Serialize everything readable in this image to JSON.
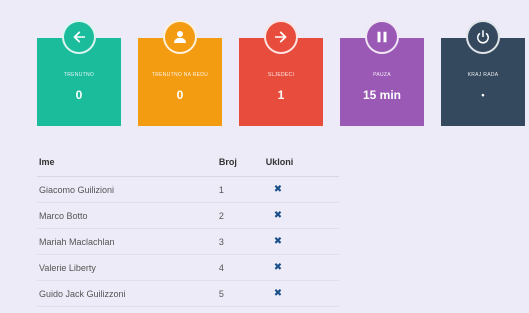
{
  "tiles": [
    {
      "label": "Trenutno",
      "value": "0",
      "icon": "arrow-left-icon",
      "color": "#1abc9c"
    },
    {
      "label": "Trenutno na redu",
      "value": "0",
      "icon": "user-icon",
      "color": "#f39c12"
    },
    {
      "label": "Sljedeći",
      "value": "1",
      "icon": "arrow-right-icon",
      "color": "#e74c3c"
    },
    {
      "label": "Pauza",
      "value": "15 min",
      "icon": "pause-icon",
      "color": "#9b59b6"
    },
    {
      "label": "Kraj rada",
      "value": "•",
      "icon": "power-icon",
      "color": "#34495e"
    }
  ],
  "table": {
    "headers": {
      "name": "Ime",
      "num": "Broj",
      "remove": "Ukloni"
    },
    "rows": [
      {
        "name": "Giacomo Guilizioni",
        "num": "1",
        "remove": "✖"
      },
      {
        "name": "Marco Botto",
        "num": "2",
        "remove": "✖"
      },
      {
        "name": "Mariah Maclachlan",
        "num": "3",
        "remove": "✖"
      },
      {
        "name": "Valerie Liberty",
        "num": "4",
        "remove": "✖"
      },
      {
        "name": "Guido Jack Guilizzoni",
        "num": "5",
        "remove": "✖"
      }
    ]
  }
}
